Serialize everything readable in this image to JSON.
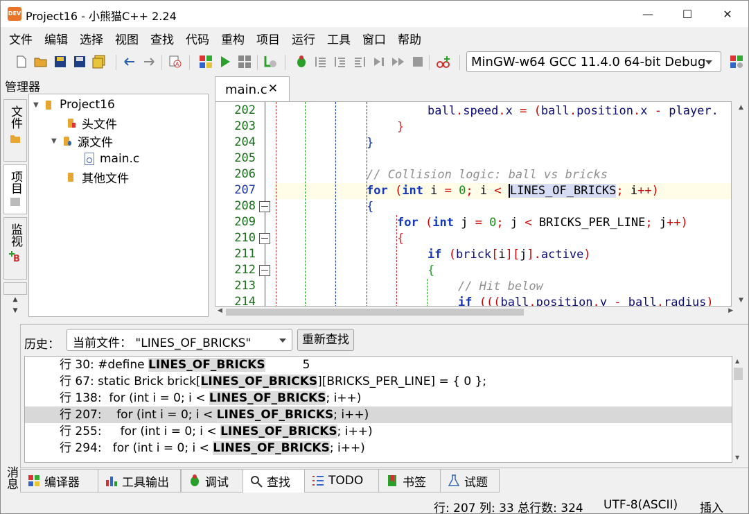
{
  "window": {
    "title": "Project16 - 小熊猫C++ 2.24",
    "app_icon_text": "DEV",
    "minimize": "—",
    "maximize": "☐",
    "close": "✕"
  },
  "menu": [
    "文件",
    "编辑",
    "选择",
    "视图",
    "查找",
    "代码",
    "重构",
    "项目",
    "运行",
    "工具",
    "窗口",
    "帮助"
  ],
  "toolbar": {
    "compiler": "MinGW-w64 GCC 11.4.0 64-bit Debug"
  },
  "manager": {
    "title": "管理器",
    "tabs": [
      "文件",
      "项目",
      "监视"
    ],
    "tree": {
      "project": "Project16",
      "headers": "头文件",
      "sources": "源文件",
      "main": "main.c",
      "others": "其他文件"
    }
  },
  "editor": {
    "tab": "main.c",
    "tab_close": "✕",
    "current_line": "207",
    "lines": [
      {
        "num": "202",
        "text": "ball.speed.x = (ball.position.x - player."
      },
      {
        "num": "203",
        "text": "}"
      },
      {
        "num": "204",
        "text": "}"
      },
      {
        "num": "205",
        "text": ""
      },
      {
        "num": "206",
        "text": "// Collision logic: ball vs bricks"
      },
      {
        "num": "207",
        "text": "for (int i = 0; i < LINES_OF_BRICKS; i++)"
      },
      {
        "num": "208",
        "text": "{"
      },
      {
        "num": "209",
        "text": "for (int j = 0; j < BRICKS_PER_LINE; j++)"
      },
      {
        "num": "210",
        "text": "{"
      },
      {
        "num": "211",
        "text": "if (brick[i][j].active)"
      },
      {
        "num": "212",
        "text": "{"
      },
      {
        "num": "213",
        "text": "// Hit below"
      },
      {
        "num": "214",
        "text": "if (((ball.position.y - ball.radius)"
      }
    ]
  },
  "search": {
    "history_label": "历史：",
    "history_value": "当前文件：  \"LINES_OF_BRICKS\"",
    "research_button": "重新查找",
    "results": [
      {
        "prefix": "行 30: #define ",
        "match": "LINES_OF_BRICKS",
        "suffix": "          5"
      },
      {
        "prefix": "行 67: static Brick brick[",
        "match": "LINES_OF_BRICKS",
        "suffix": "][BRICKS_PER_LINE] = { 0 };"
      },
      {
        "prefix": "行 138:  for (int i = 0; i < ",
        "match": "LINES_OF_BRICKS",
        "suffix": "; i++)"
      },
      {
        "prefix": "行 207:    for (int i = 0; i < ",
        "match": "LINES_OF_BRICKS",
        "suffix": "; i++)"
      },
      {
        "prefix": "行 255:     for (int i = 0; i < ",
        "match": "LINES_OF_BRICKS",
        "suffix": "; i++)"
      },
      {
        "prefix": "行 294:   for (int i = 0; i < ",
        "match": "LINES_OF_BRICKS",
        "suffix": "; i++)"
      }
    ]
  },
  "messages_label": "消息",
  "bottom_tabs": [
    "编译器",
    "工具输出",
    "调试",
    "查找",
    "TODO",
    "书签",
    "试题"
  ],
  "status": {
    "position": "行: 207 列: 33 总行数: 324",
    "encoding": "UTF-8(ASCII)",
    "mode": "插入"
  }
}
